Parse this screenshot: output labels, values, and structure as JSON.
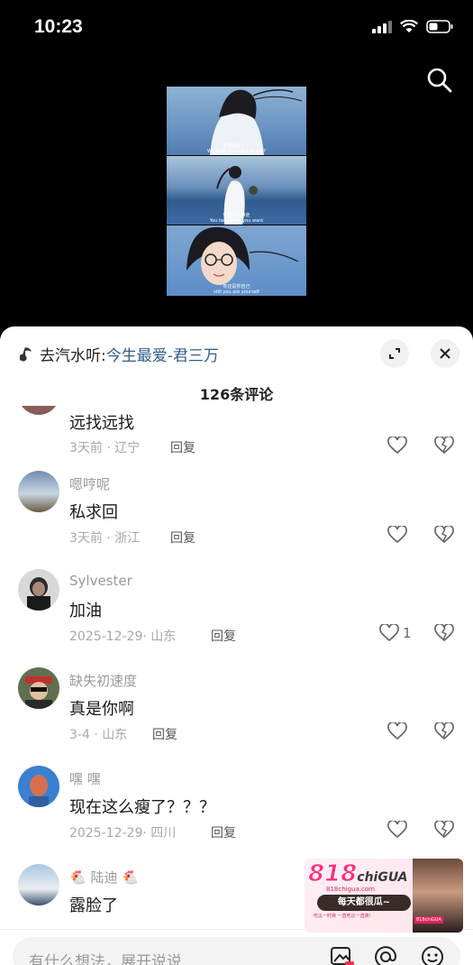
{
  "status_bar": {
    "time": "10:23"
  },
  "video": {
    "subtitles": [
      "你想说什么？",
      "你把什么带走",
      "你还是你自己"
    ],
    "subtitles_en": [
      "What do you want to say?",
      "You take what you want",
      "still you are yourself"
    ]
  },
  "sheet": {
    "music_prefix": "去汽水听:",
    "music_song": "今生最爱-君三万",
    "comment_count": "126条评论"
  },
  "comments": [
    {
      "name": "",
      "text": "远找远找",
      "date": "3天前",
      "location": "辽宁",
      "reply": "回复",
      "likes": ""
    },
    {
      "name": "嗯哼呢",
      "text": "私求回",
      "date": "3天前",
      "location": "浙江",
      "reply": "回复",
      "likes": ""
    },
    {
      "name": "Sylvester",
      "text": "加油",
      "date": "2025-12-29",
      "location": "山东",
      "reply": "回复",
      "likes": "1"
    },
    {
      "name": "缺失初速度",
      "text": "真是你啊",
      "date": "3-4",
      "location": "山东",
      "reply": "回复",
      "likes": ""
    },
    {
      "name": "嘿 嘿",
      "text": "现在这么瘦了？？？",
      "date": "2025-12-29",
      "location": "四川",
      "reply": "回复",
      "likes": ""
    },
    {
      "name": "陆迪",
      "text": "露脸了",
      "date": "",
      "location": "",
      "reply": "",
      "likes": ""
    }
  ],
  "input": {
    "placeholder": "有什么想法，展开说说"
  },
  "ad": {
    "logo_num": "818",
    "logo_word": "chiGUA",
    "domain": "818chigua.com",
    "slogan": "每天都很瓜~",
    "small_text": "吃瓜一时爽 一直吃瓜一直爽!",
    "tag": "818chiGUA"
  },
  "colors": {
    "accent": "#2f5f8a",
    "sheet_bg": "#ffffff",
    "ad_pink": "#ff2d7a"
  }
}
